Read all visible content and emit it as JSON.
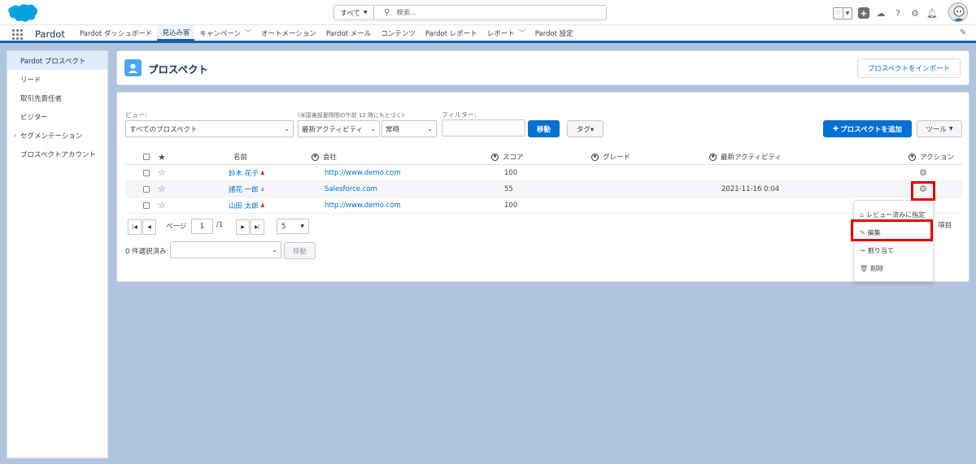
{
  "header": {
    "search_scope": "すべて",
    "search_placeholder": "検索..."
  },
  "nav": {
    "app_name": "Pardot",
    "items": [
      {
        "label": "Pardot ダッシュボード",
        "has_menu": false
      },
      {
        "label": "見込み客",
        "active": true
      },
      {
        "label": "キャンペーン",
        "has_menu": true
      },
      {
        "label": "オートメーション"
      },
      {
        "label": "Pardot メール"
      },
      {
        "label": "コンテンツ"
      },
      {
        "label": "Pardot レポート"
      },
      {
        "label": "レポート",
        "has_menu": true
      },
      {
        "label": "Pardot 設定"
      }
    ]
  },
  "sidebar": {
    "items": [
      {
        "label": "Pardot プロスペクト",
        "active": true
      },
      {
        "label": "リード"
      },
      {
        "label": "取引先責任者"
      },
      {
        "label": "ビジター"
      },
      {
        "label": "セグメンテーション",
        "expandable": true
      },
      {
        "label": "プロスペクトアカウント"
      }
    ]
  },
  "page": {
    "title": "プロスペクト",
    "import_button": "プロスペクトをインポート"
  },
  "filters": {
    "view_label": "ビュー:",
    "view_value": "すべてのプロスペクト",
    "time_label": "(米国東部夏時間の午前 12 時にもとづく):",
    "activity_value": "最新アクティビティ",
    "period_value": "常時",
    "filter_label": "フィルター:",
    "filter_value": "",
    "go_button": "移動",
    "tag_button": "タグ▾",
    "add_button": "プロスペクトを追加",
    "tools_button": "ツール"
  },
  "table": {
    "headers": {
      "name": "名前",
      "company": "会社",
      "score": "スコア",
      "grade": "グレード",
      "last_activity": "最新アクティビティ",
      "action": "アクション"
    },
    "rows": [
      {
        "name": "鈴木 花子",
        "company": "http://www.demo.com",
        "score": "100",
        "grade": "",
        "last_activity": ""
      },
      {
        "name": "諸花 一郎",
        "company": "Salesforce.com",
        "score": "55",
        "grade": "",
        "last_activity": "2021-11-16 0:04"
      },
      {
        "name": "山田 太郎",
        "company": "http://www.demo.com",
        "score": "100",
        "grade": "",
        "last_activity": ""
      }
    ]
  },
  "pagination": {
    "page_label": "ページ",
    "current_page": "1",
    "total_pages": "/1",
    "per_page": "5",
    "items_suffix": "項目"
  },
  "bulk": {
    "selected_label": "0 件選択済み:",
    "go_button": "移動"
  },
  "action_menu": {
    "items": [
      {
        "label": "レビュー済みに指定",
        "icon": "archive-icon"
      },
      {
        "label": "編集",
        "icon": "edit-icon"
      },
      {
        "label": "割り当て",
        "icon": "share-icon"
      },
      {
        "label": "削除",
        "icon": "trash-icon"
      }
    ]
  },
  "colors": {
    "brand_blue": "#0070d2",
    "nav_underline": "#1b5ea9",
    "highlight_red": "#e00000",
    "background": "#b0c4df"
  }
}
